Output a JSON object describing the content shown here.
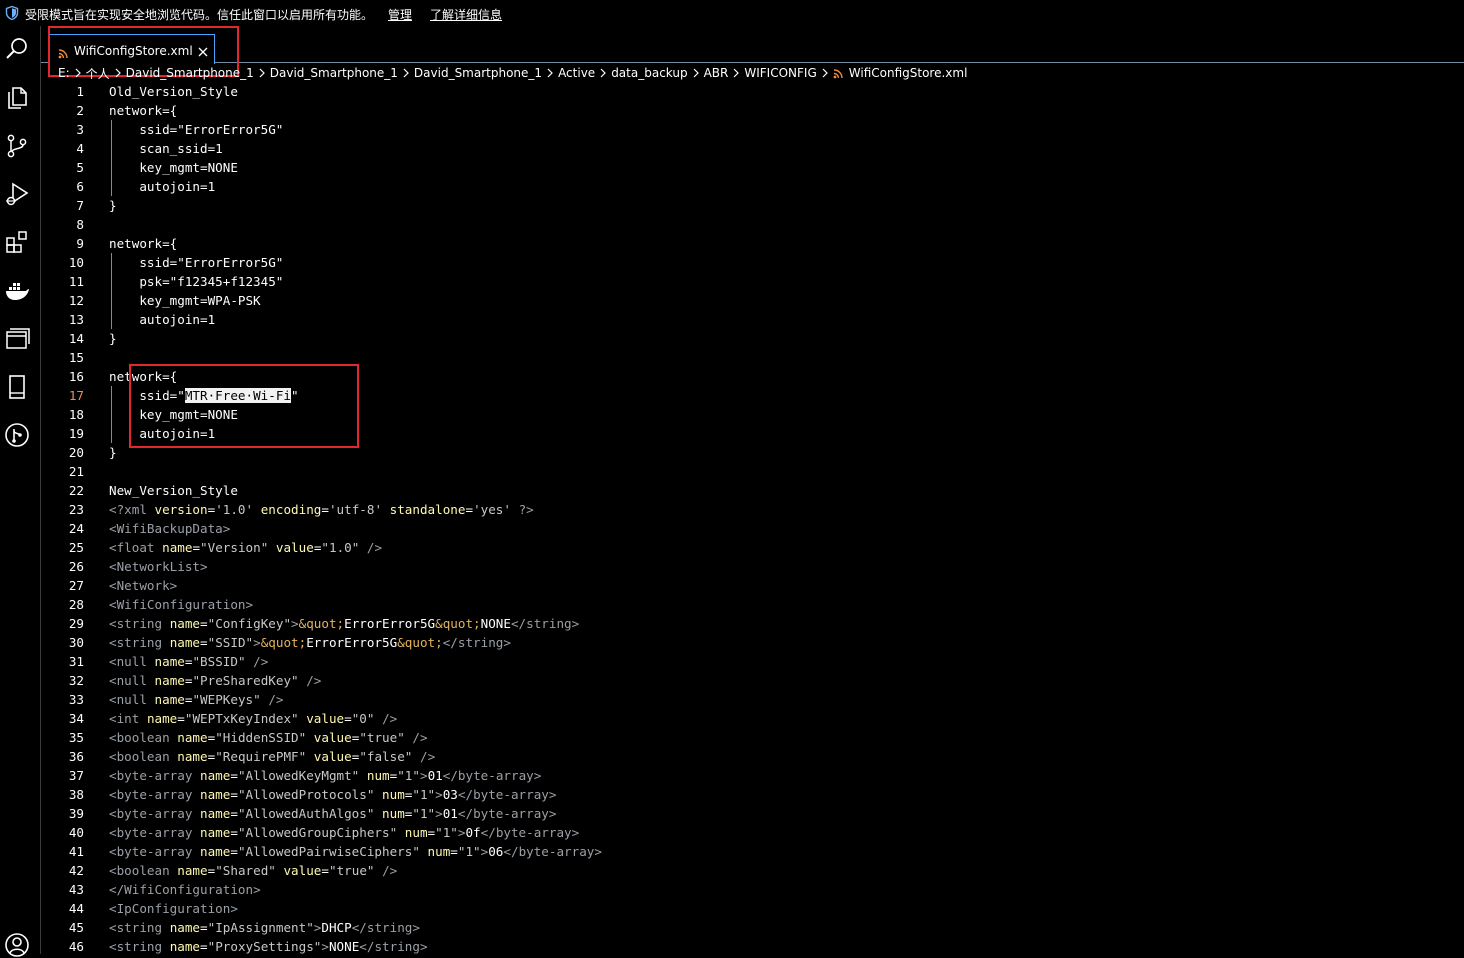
{
  "banner": {
    "message": "受限模式旨在实现安全地浏览代码。信任此窗口以启用所有功能。",
    "manage_link": "管理",
    "learn_more_link": "了解详细信息"
  },
  "activity_bar": {
    "icons": [
      "search-icon",
      "explorer-icon",
      "source-control-icon",
      "run-debug-icon",
      "extensions-icon",
      "docker-icon",
      "remote-explorer-icon",
      "tablet-icon",
      "git-graph-icon",
      "account-icon"
    ]
  },
  "tab": {
    "label": "WifiConfigStore.xml",
    "close": "×"
  },
  "breadcrumb": {
    "items": [
      "E:",
      "个人",
      "David_Smartphone_1",
      "David_Smartphone_1",
      "David_Smartphone_1",
      "Active",
      "data_backup",
      "ABR",
      "WIFICONFIG"
    ],
    "file": "WifiConfigStore.xml"
  },
  "editor": {
    "current_line": 17,
    "lines": [
      {
        "n": "1",
        "code": "Old_Version_Style"
      },
      {
        "n": "2",
        "code": "network={"
      },
      {
        "n": "3",
        "code": "    ssid=\"ErrorError5G\""
      },
      {
        "n": "4",
        "code": "    scan_ssid=1"
      },
      {
        "n": "5",
        "code": "    key_mgmt=NONE"
      },
      {
        "n": "6",
        "code": "    autojoin=1"
      },
      {
        "n": "7",
        "code": "}"
      },
      {
        "n": "8",
        "code": ""
      },
      {
        "n": "9",
        "code": "network={"
      },
      {
        "n": "10",
        "code": "    ssid=\"ErrorError5G\""
      },
      {
        "n": "11",
        "code": "    psk=\"f12345+f12345\""
      },
      {
        "n": "12",
        "code": "    key_mgmt=WPA-PSK"
      },
      {
        "n": "13",
        "code": "    autojoin=1"
      },
      {
        "n": "14",
        "code": "}"
      },
      {
        "n": "15",
        "code": ""
      },
      {
        "n": "16",
        "code": "network={"
      },
      {
        "n": "17",
        "code": "    ssid=\"MTR·Free·Wi-Fi\""
      },
      {
        "n": "18",
        "code": "    key_mgmt=NONE"
      },
      {
        "n": "19",
        "code": "    autojoin=1"
      },
      {
        "n": "20",
        "code": "}"
      },
      {
        "n": "21",
        "code": ""
      },
      {
        "n": "22",
        "code": "New_Version_Style"
      },
      {
        "n": "23",
        "code": "<?xml version='1.0' encoding='utf-8' standalone='yes' ?>"
      },
      {
        "n": "24",
        "code": "<WifiBackupData>"
      },
      {
        "n": "25",
        "code": "<float name=\"Version\" value=\"1.0\" />"
      },
      {
        "n": "26",
        "code": "<NetworkList>"
      },
      {
        "n": "27",
        "code": "<Network>"
      },
      {
        "n": "28",
        "code": "<WifiConfiguration>"
      },
      {
        "n": "29",
        "code": "<string name=\"ConfigKey\">&quot;ErrorError5G&quot;NONE</string>"
      },
      {
        "n": "30",
        "code": "<string name=\"SSID\">&quot;ErrorError5G&quot;</string>"
      },
      {
        "n": "31",
        "code": "<null name=\"BSSID\" />"
      },
      {
        "n": "32",
        "code": "<null name=\"PreSharedKey\" />"
      },
      {
        "n": "33",
        "code": "<null name=\"WEPKeys\" />"
      },
      {
        "n": "34",
        "code": "<int name=\"WEPTxKeyIndex\" value=\"0\" />"
      },
      {
        "n": "35",
        "code": "<boolean name=\"HiddenSSID\" value=\"true\" />"
      },
      {
        "n": "36",
        "code": "<boolean name=\"RequirePMF\" value=\"false\" />"
      },
      {
        "n": "37",
        "code": "<byte-array name=\"AllowedKeyMgmt\" num=\"1\">01</byte-array>"
      },
      {
        "n": "38",
        "code": "<byte-array name=\"AllowedProtocols\" num=\"1\">03</byte-array>"
      },
      {
        "n": "39",
        "code": "<byte-array name=\"AllowedAuthAlgos\" num=\"1\">01</byte-array>"
      },
      {
        "n": "40",
        "code": "<byte-array name=\"AllowedGroupCiphers\" num=\"1\">0f</byte-array>"
      },
      {
        "n": "41",
        "code": "<byte-array name=\"AllowedPairwiseCiphers\" num=\"1\">06</byte-array>"
      },
      {
        "n": "42",
        "code": "<boolean name=\"Shared\" value=\"true\" />"
      },
      {
        "n": "43",
        "code": "</WifiConfiguration>"
      },
      {
        "n": "44",
        "code": "<IpConfiguration>"
      },
      {
        "n": "45",
        "code": "<string name=\"IpAssignment\">DHCP</string>"
      },
      {
        "n": "46",
        "code": "<string name=\"ProxySettings\">NONE</string>"
      }
    ]
  }
}
